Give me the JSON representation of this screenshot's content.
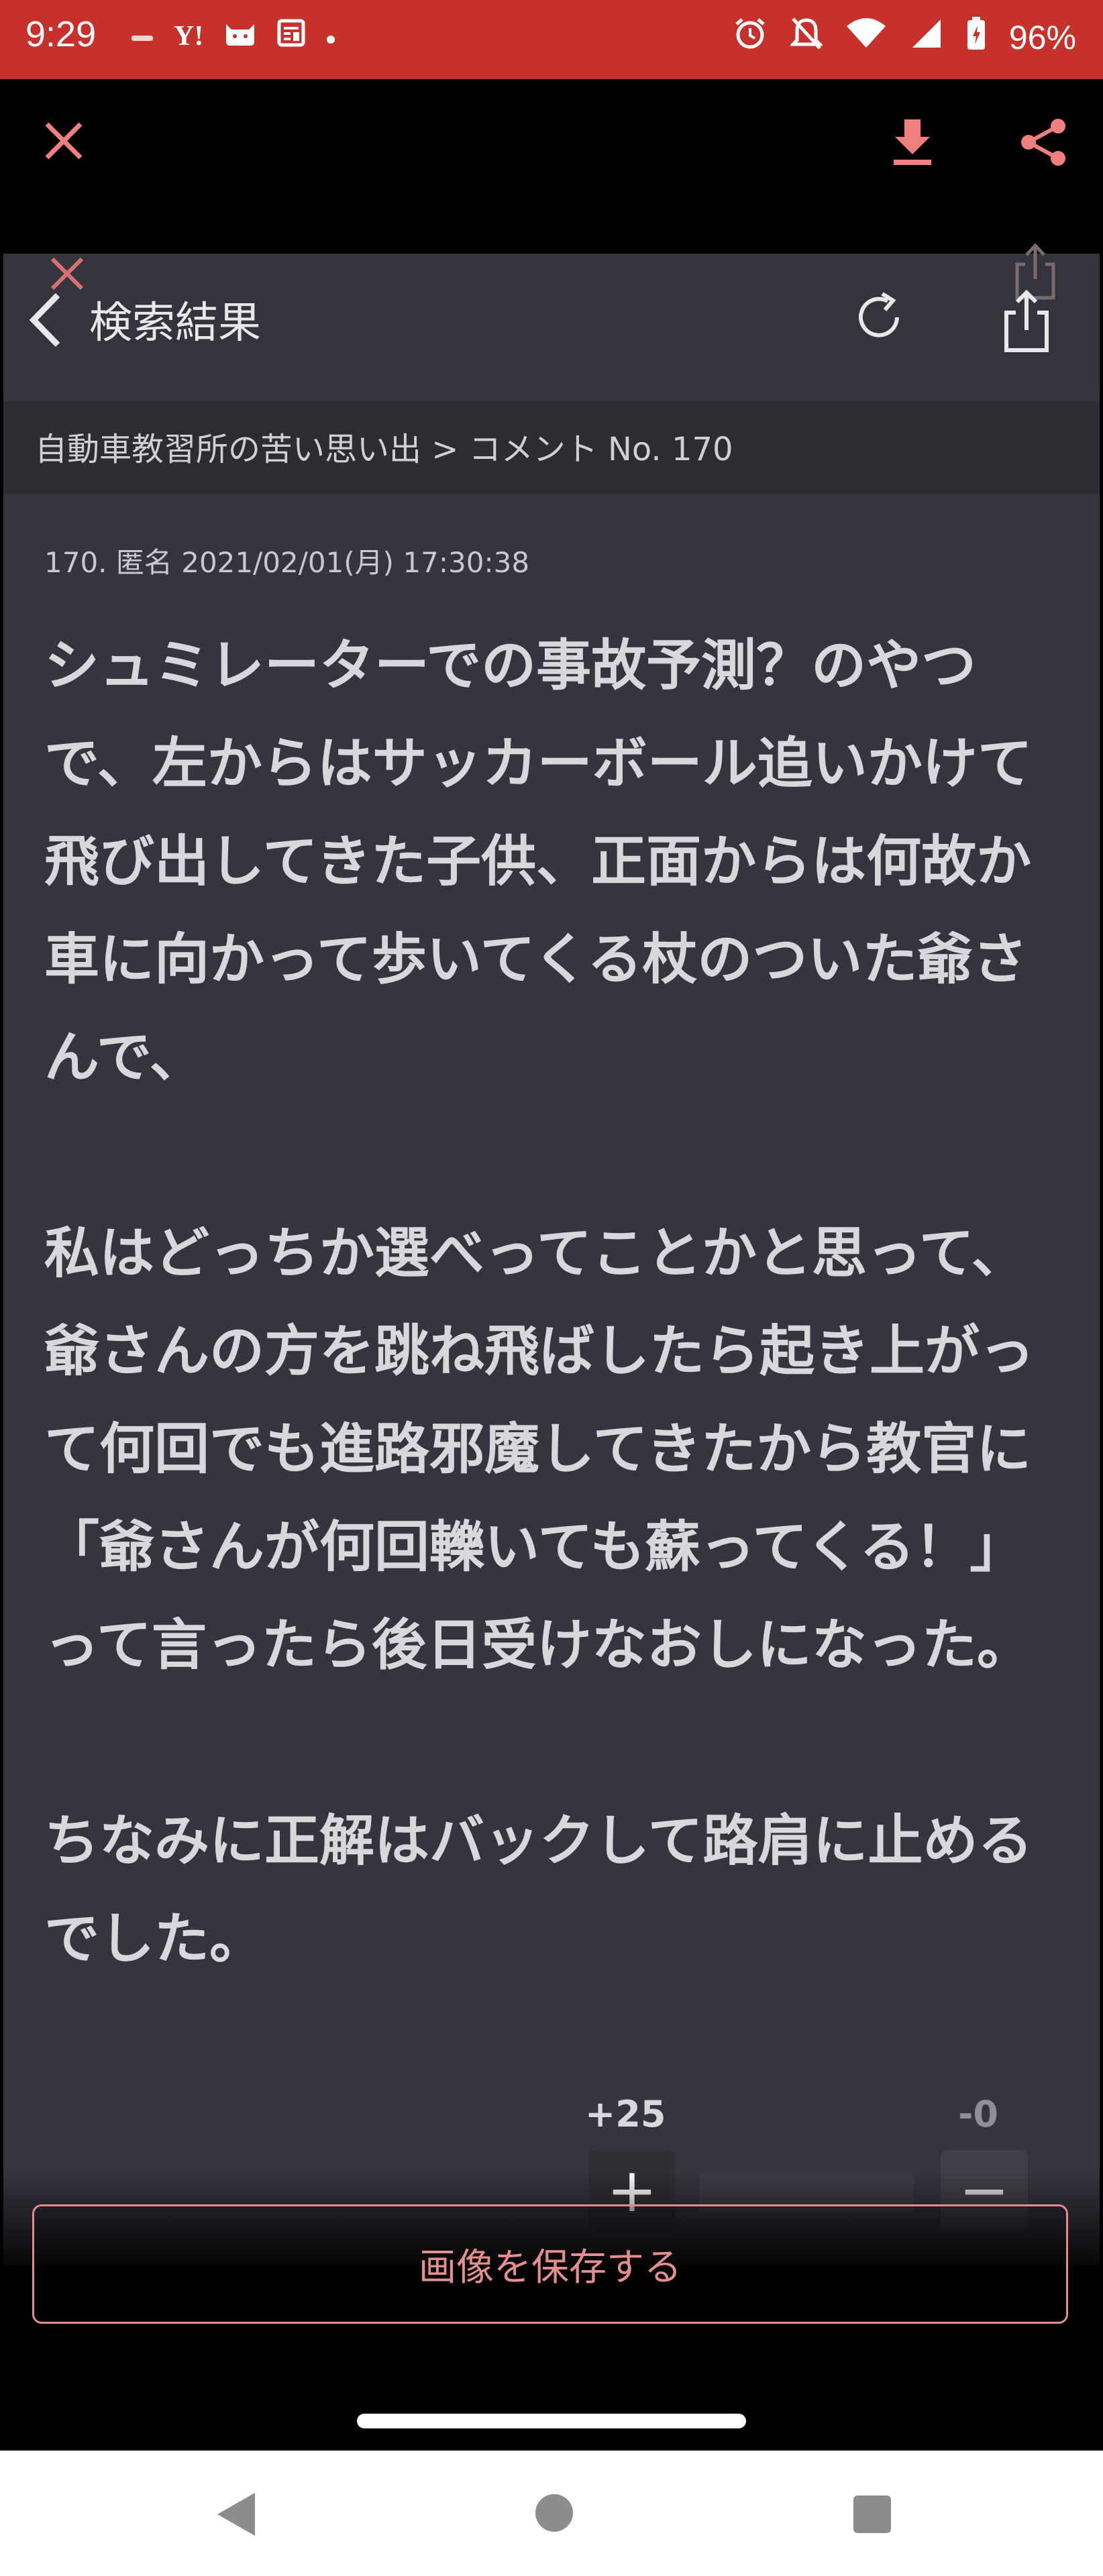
{
  "status_bar": {
    "time": "9:29",
    "battery": "96%",
    "icons_left": [
      "notification-icon",
      "yahoo-icon",
      "cat-icon",
      "news-icon",
      "dot-icon"
    ],
    "icons_right": [
      "alarm-icon",
      "mute-icon",
      "wifi-icon",
      "signal-icon",
      "battery-icon"
    ],
    "yahoo_glyph": "Y!",
    "background": "#c6312b"
  },
  "viewer_toolbar": {
    "close_icon": "close-icon",
    "download_icon": "download-icon",
    "share_icon": "share-icon",
    "accent": "#f08080"
  },
  "screenshot": {
    "nav": {
      "back_icon": "chevron-left-icon",
      "title": "検索結果",
      "reload_icon": "reload-icon",
      "share_icon": "share-icon"
    },
    "breadcrumb": "自動車教習所の苦い思い出 > コメント No. 170",
    "comment": {
      "meta": "170. 匿名 2021/02/01(月) 17:30:38",
      "paragraphs": [
        "シュミレーターでの事故予測？のやつで、左からはサッカーボール追いかけて飛び出してきた子供、正面からは何故か車に向かって歩いてくる杖のついた爺さんで、",
        "私はどっちか選べってことかと思って、爺さんの方を跳ね飛ばしたら起き上がって何回でも進路邪魔してきたから教官に「爺さんが何回轢いても蘇ってくる！」って言ったら後日受けなおしになった。",
        "ちなみに正解はバックして路肩に止めるでした。"
      ]
    },
    "votes": {
      "plus_count": "+25",
      "minus_count": "-0",
      "plus_label": "+",
      "minus_label": "−",
      "plus_fraction": 1.0
    }
  },
  "save_button": {
    "label": "画像を保存する",
    "color": "#e58e8e"
  },
  "system_nav": {
    "back_icon": "back-triangle-icon",
    "home_icon": "home-circle-icon",
    "recents_icon": "recents-square-icon"
  }
}
